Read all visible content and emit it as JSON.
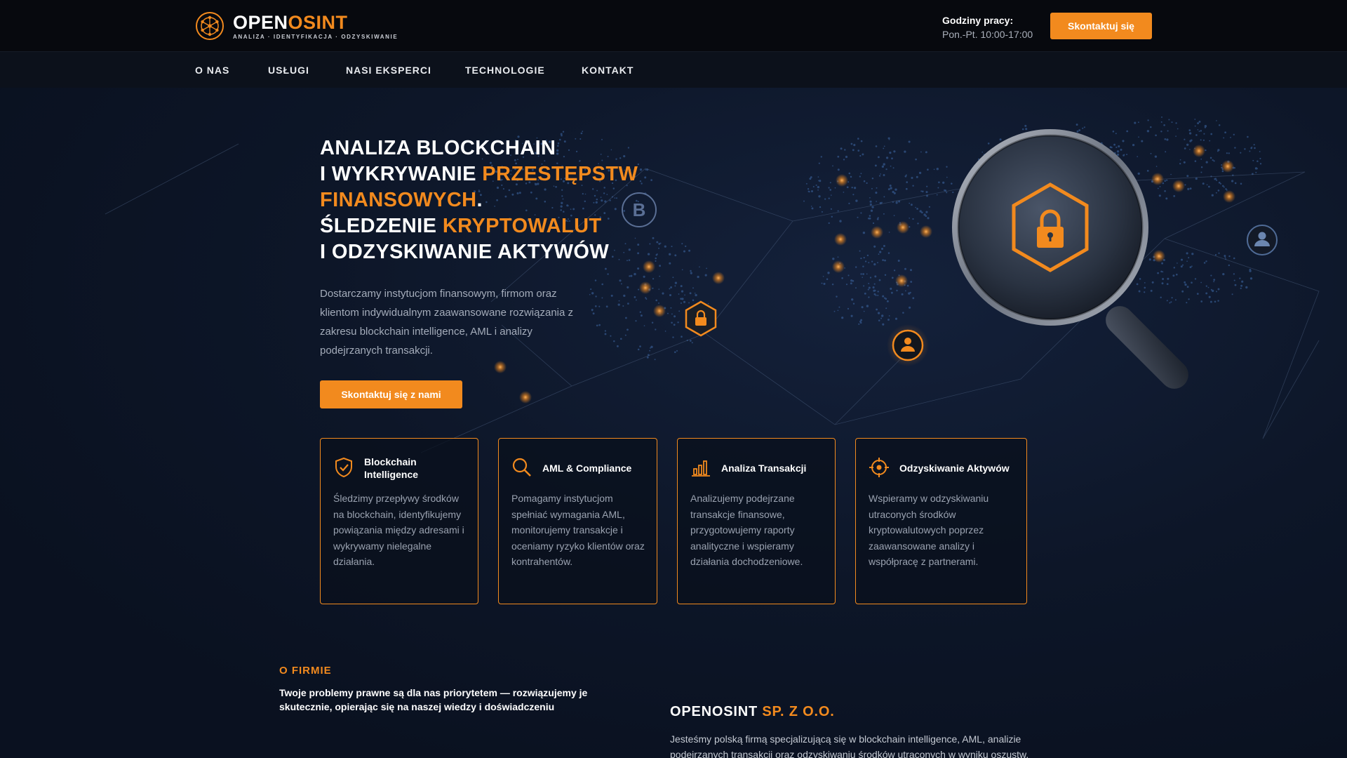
{
  "header": {
    "brand_part1": "OPEN",
    "brand_part2": "OSINT",
    "tagline": "ANALIZA · IDENTYFIKACJA · ODZYSKIWANIE",
    "hours_label": "Godziny pracy:",
    "hours_value": "Pon.-Pt. 10:00-17:00",
    "contact_button": "Skontaktuj się"
  },
  "nav": {
    "items": [
      {
        "label": "O NAS"
      },
      {
        "label": "USŁUGI"
      },
      {
        "label": "NASI EKSPERCI"
      },
      {
        "label": "TECHNOLOGIE"
      },
      {
        "label": "KONTAKT"
      }
    ]
  },
  "hero": {
    "line1": "ANALIZA BLOCKCHAIN",
    "line2a": "I WYKRYWANIE ",
    "line2b": "PRZESTĘPSTW",
    "line3a": "FINANSOWYCH",
    "line3b": ".",
    "line4a": "ŚLEDZENIE ",
    "line4b": "KRYPTOWALUT",
    "line5": "I ODZYSKIWANIE AKTYWÓW",
    "description": "Dostarczamy instytucjom finansowym, firmom oraz klientom indywidualnym zaawansowane rozwiązania z zakresu blockchain intelligence, AML i analizy podejrzanych transakcji.",
    "cta": "Skontaktuj się z nami",
    "bitcoin_symbol": "B"
  },
  "cards": [
    {
      "icon": "shield-check-icon",
      "title": "Blockchain Intelligence",
      "text": "Śledzimy przepływy środków na blockchain, identyfikujemy powiązania między adresami i wykrywamy nielegalne działania."
    },
    {
      "icon": "search-icon",
      "title": "AML & Compliance",
      "text": "Pomagamy instytucjom spełniać wymagania AML, monitorujemy transakcje i oceniamy ryzyko klientów oraz kontrahentów."
    },
    {
      "icon": "bar-chart-icon",
      "title": "Analiza Transakcji",
      "text": "Analizujemy podejrzane transakcje finansowe, przygotowujemy raporty analityczne i wspieramy działania dochodzeniowe."
    },
    {
      "icon": "target-icon",
      "title": "Odzyskiwanie Aktywów",
      "text": "Wspieramy w odzyskiwaniu utraconych środków kryptowalutowych poprzez zaawansowane analizy i współpracę z partnerami."
    }
  ],
  "about": {
    "label": "O FIRMIE",
    "lead": "Twoje problemy prawne są dla nas priorytetem — rozwiązujemy je skutecznie, opierając się na naszej wiedzy i doświadczeniu",
    "company_name_part1": "OPENOSINT ",
    "company_name_part2": "SP. Z O.O.",
    "company_text": "Jesteśmy polską firmą specjalizującą się w blockchain intelligence, AML, analizie podejrzanych transakcji oraz odzyskiwaniu środków utraconych w wyniku oszustw."
  },
  "colors": {
    "accent": "#f28a1e",
    "background": "#0b1220",
    "topbar": "#07090e"
  }
}
